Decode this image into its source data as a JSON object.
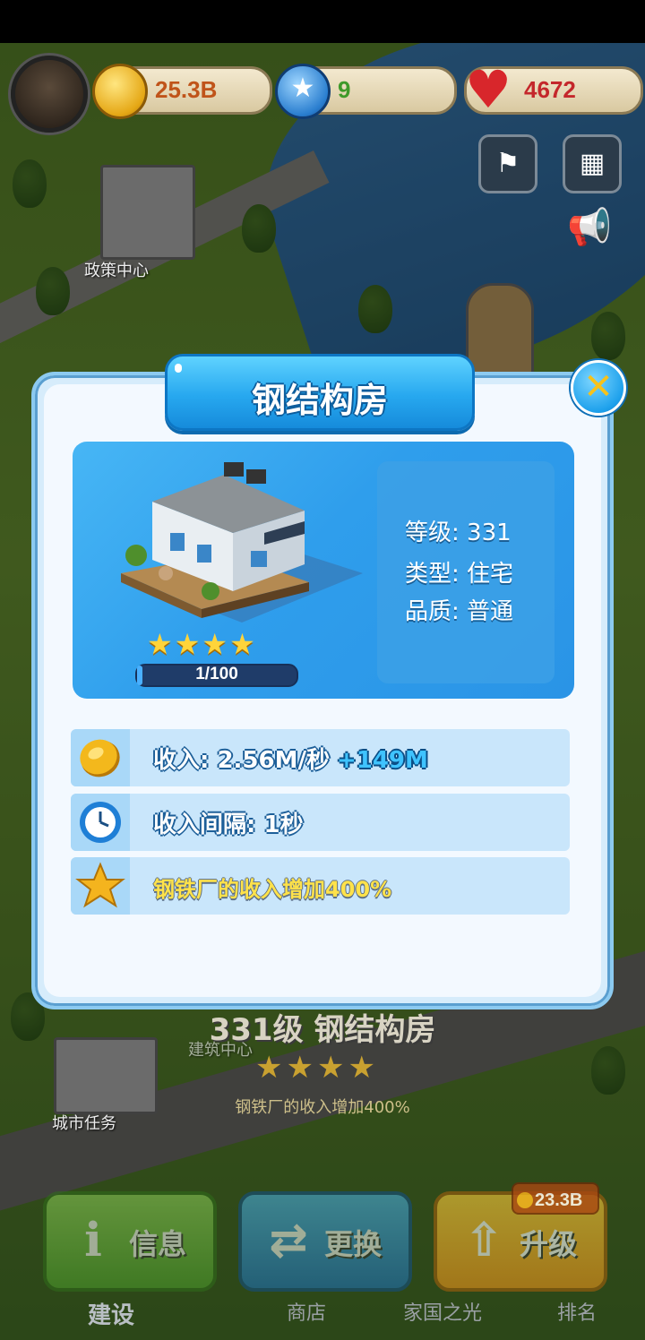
{
  "hud": {
    "coins": "25.3B",
    "gems": "9",
    "hearts": "4672"
  },
  "map_labels": {
    "policy_center": "政策中心",
    "city_tasks": "城市任务",
    "build_center": "建筑中心"
  },
  "background": {
    "title": "331级 钢结构房",
    "bonus": "钢铁厂的收入增加400%"
  },
  "dialog": {
    "title": "钢结构房",
    "stars": "★★★★",
    "progress_text": "1/100",
    "progress_fraction": 0.01,
    "stats": {
      "level": "等级: 331",
      "type": "类型: 住宅",
      "quality": "品质: 普通"
    },
    "rows": {
      "income": "收入: 2.56M/秒",
      "income_plus": "+149M",
      "interval": "收入间隔: 1秒",
      "bonus": "钢铁厂的收入增加400%"
    }
  },
  "actions": {
    "info": "信息",
    "swap": "更换",
    "upgrade": "升级",
    "upgrade_cost": "23.3B"
  },
  "nav": {
    "build": "建设",
    "shop": "商店",
    "home_light": "家国之光",
    "rank": "排名"
  },
  "icons": {
    "coin": "coin-icon",
    "gem": "star-gem-icon",
    "heart": "heart-icon",
    "clock": "clock-icon",
    "star": "star-icon",
    "close": "close-icon"
  },
  "colors": {
    "coin_text": "#c0541a",
    "gem_text": "#3f9a2a",
    "heart_text": "#c4272b",
    "dialog_blue": "#27a8ef"
  }
}
